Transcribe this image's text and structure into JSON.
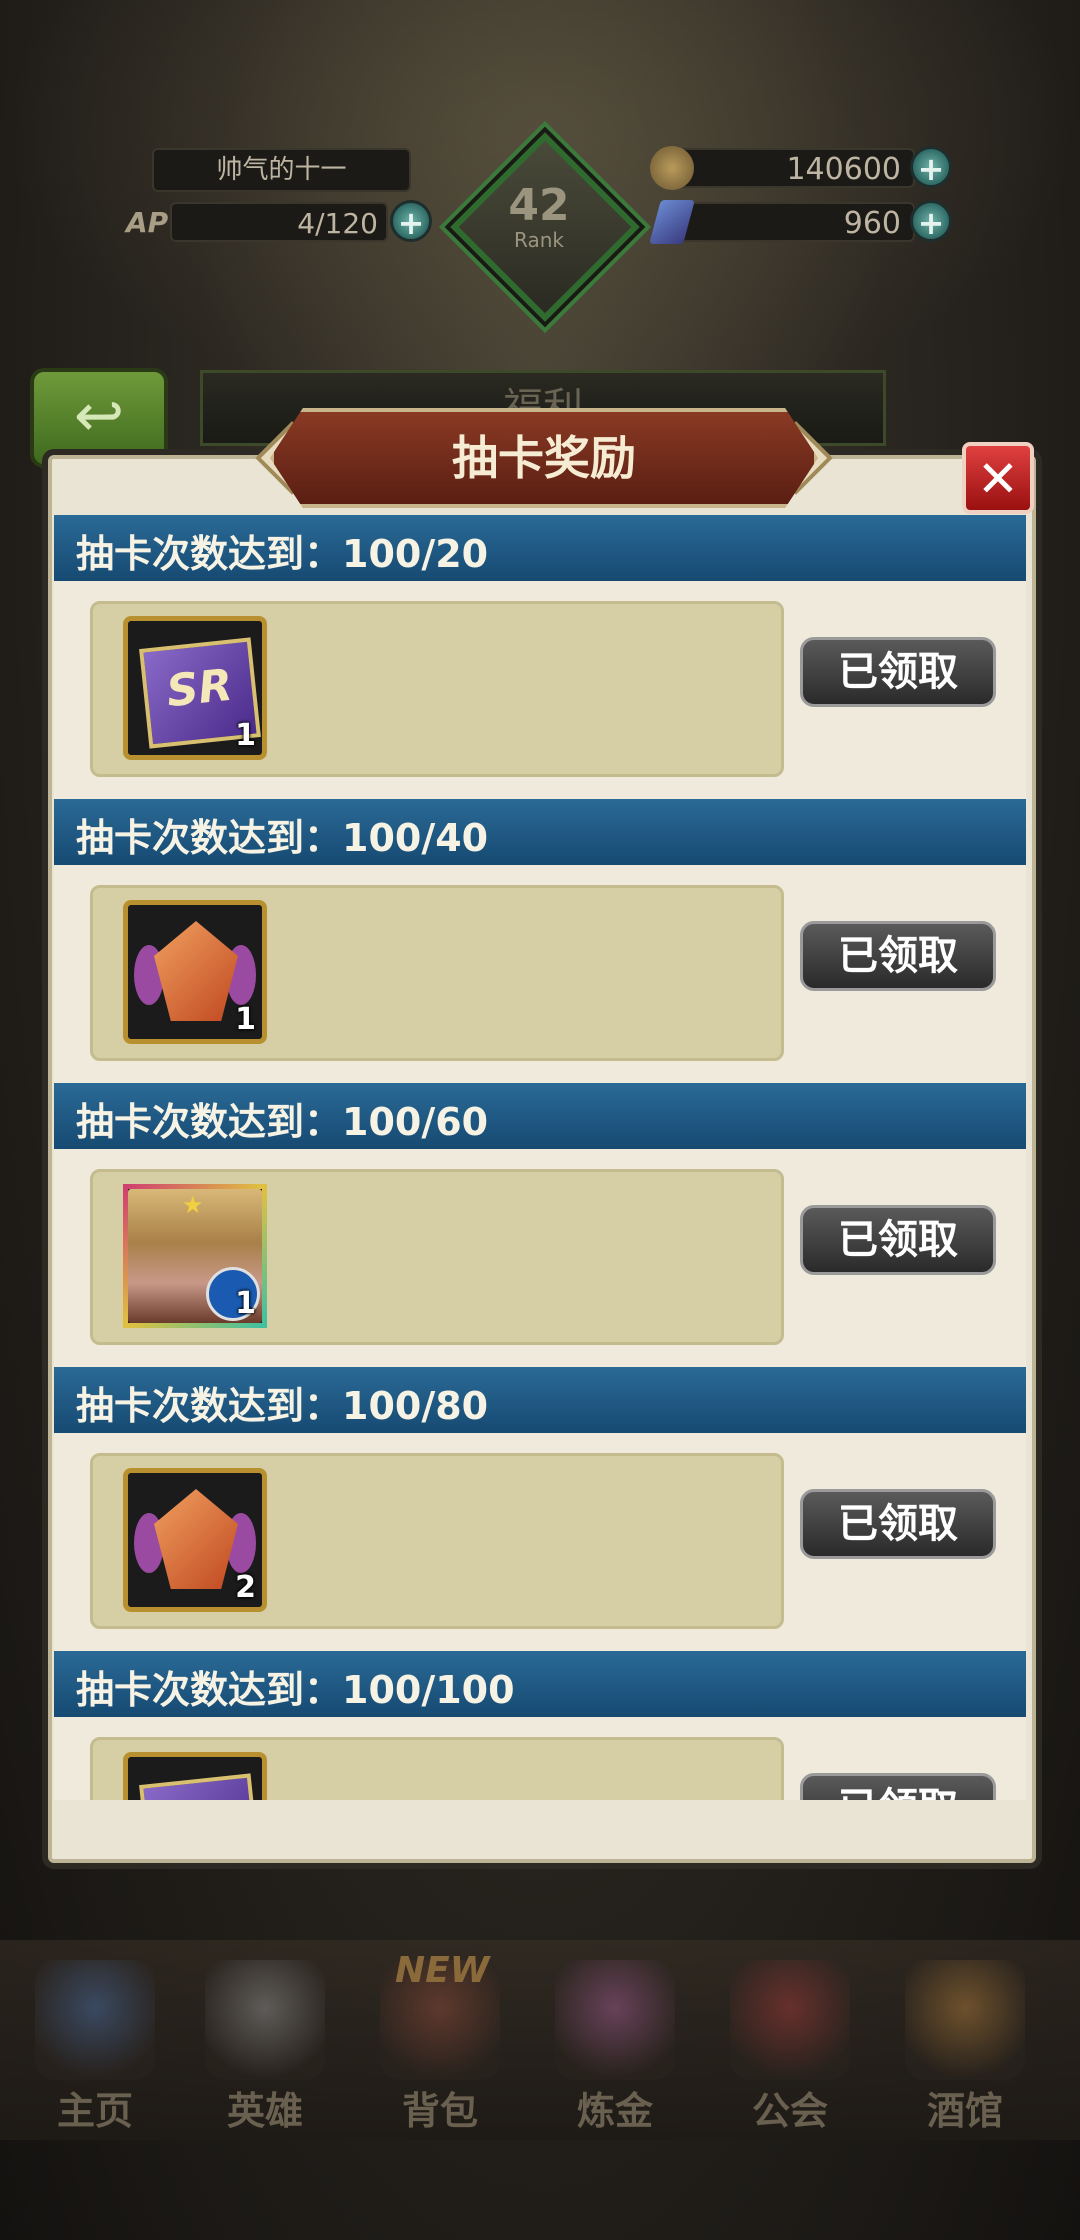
{
  "status": {
    "player_name": "帅气的十一",
    "ap_label": "AP",
    "ap_value": "4/120",
    "rank_number": "42",
    "rank_label": "Rank",
    "gold": "140600",
    "gems": "960",
    "plus_glyph": "+"
  },
  "background": {
    "back_icon": "back-arrow-icon",
    "behind_title": "福利"
  },
  "modal": {
    "title": "抽卡奖励",
    "close_glyph": "✕",
    "sections": [
      {
        "header": "抽卡次数达到：100/20",
        "item_icon": "sr-card-ticket-icon",
        "qty": "1",
        "button": "已领取"
      },
      {
        "header": "抽卡次数达到：100/40",
        "item_icon": "crystal-crest-icon",
        "qty": "1",
        "button": "已领取"
      },
      {
        "header": "抽卡次数达到：100/60",
        "item_icon": "hero-portrait-icon",
        "qty": "1",
        "button": "已领取"
      },
      {
        "header": "抽卡次数达到：100/80",
        "item_icon": "crystal-crest-icon",
        "qty": "2",
        "button": "已领取"
      },
      {
        "header": "抽卡次数达到：100/100",
        "item_icon": "sr-card-ticket-icon",
        "qty": "",
        "button": "已领取"
      }
    ],
    "sr_text": "SR"
  },
  "nav": {
    "new_badge": "NEW",
    "items": [
      {
        "label": "主页",
        "icon": "castle-icon",
        "color": "#4a6a9a"
      },
      {
        "label": "英雄",
        "icon": "knight-helmet-icon",
        "color": "#8a8a8a"
      },
      {
        "label": "背包",
        "icon": "backpack-icon",
        "color": "#8a4a3a"
      },
      {
        "label": "炼金",
        "icon": "alchemy-flask-icon",
        "color": "#9a5a8a"
      },
      {
        "label": "公会",
        "icon": "guild-shield-icon",
        "color": "#9a3a3a"
      },
      {
        "label": "酒馆",
        "icon": "beer-mug-icon",
        "color": "#a8783a"
      }
    ]
  },
  "colors": {
    "section_header": "#1e5a86",
    "button": "#3a3a3a",
    "modal_bg": "#e9e4d3",
    "close_red": "#c02020"
  }
}
